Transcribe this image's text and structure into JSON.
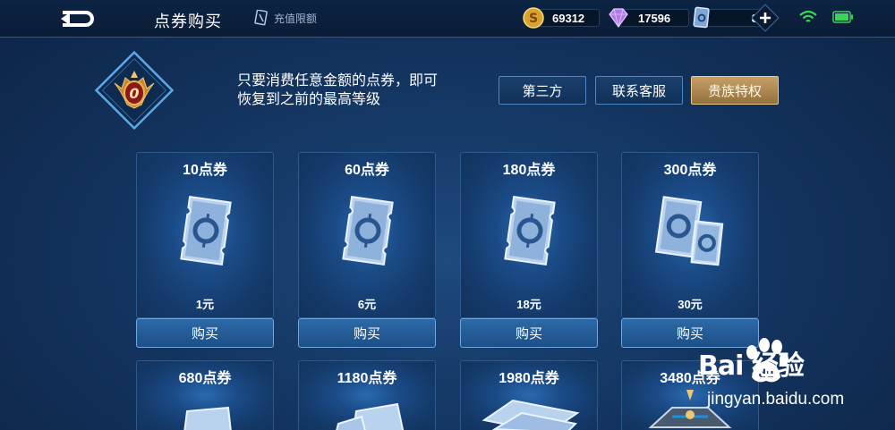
{
  "header": {
    "title": "点券购买",
    "limit_label": "充值限额",
    "coins": "69312",
    "diamonds": "17596",
    "vouchers": "8"
  },
  "rank": {
    "message": [
      "只要消费任意金额的点券，即可",
      "恢复到之前的最高等级"
    ],
    "badge_number": "0"
  },
  "tabs": [
    {
      "label": "第三方",
      "active": false
    },
    {
      "label": "联系客服",
      "active": false
    },
    {
      "label": "贵族特权",
      "active": true
    }
  ],
  "products": [
    {
      "amount": "10点券",
      "price": "1元",
      "buy": "购买"
    },
    {
      "amount": "60点券",
      "price": "6元",
      "buy": "购买"
    },
    {
      "amount": "180点券",
      "price": "18元",
      "buy": "购买"
    },
    {
      "amount": "300点券",
      "price": "30元",
      "buy": "购买"
    },
    {
      "amount": "680点券"
    },
    {
      "amount": "1180点券"
    },
    {
      "amount": "1980点券"
    },
    {
      "amount": "3480点券"
    }
  ],
  "watermark": {
    "logo": "Bai 经验",
    "url": "jingyan.baidu.com"
  },
  "colors": {
    "accent_gold": "#c6a066",
    "panel_blue": "#1a4a85",
    "border_blue": "#4f86c4",
    "battery_green": "#3ad45a"
  }
}
